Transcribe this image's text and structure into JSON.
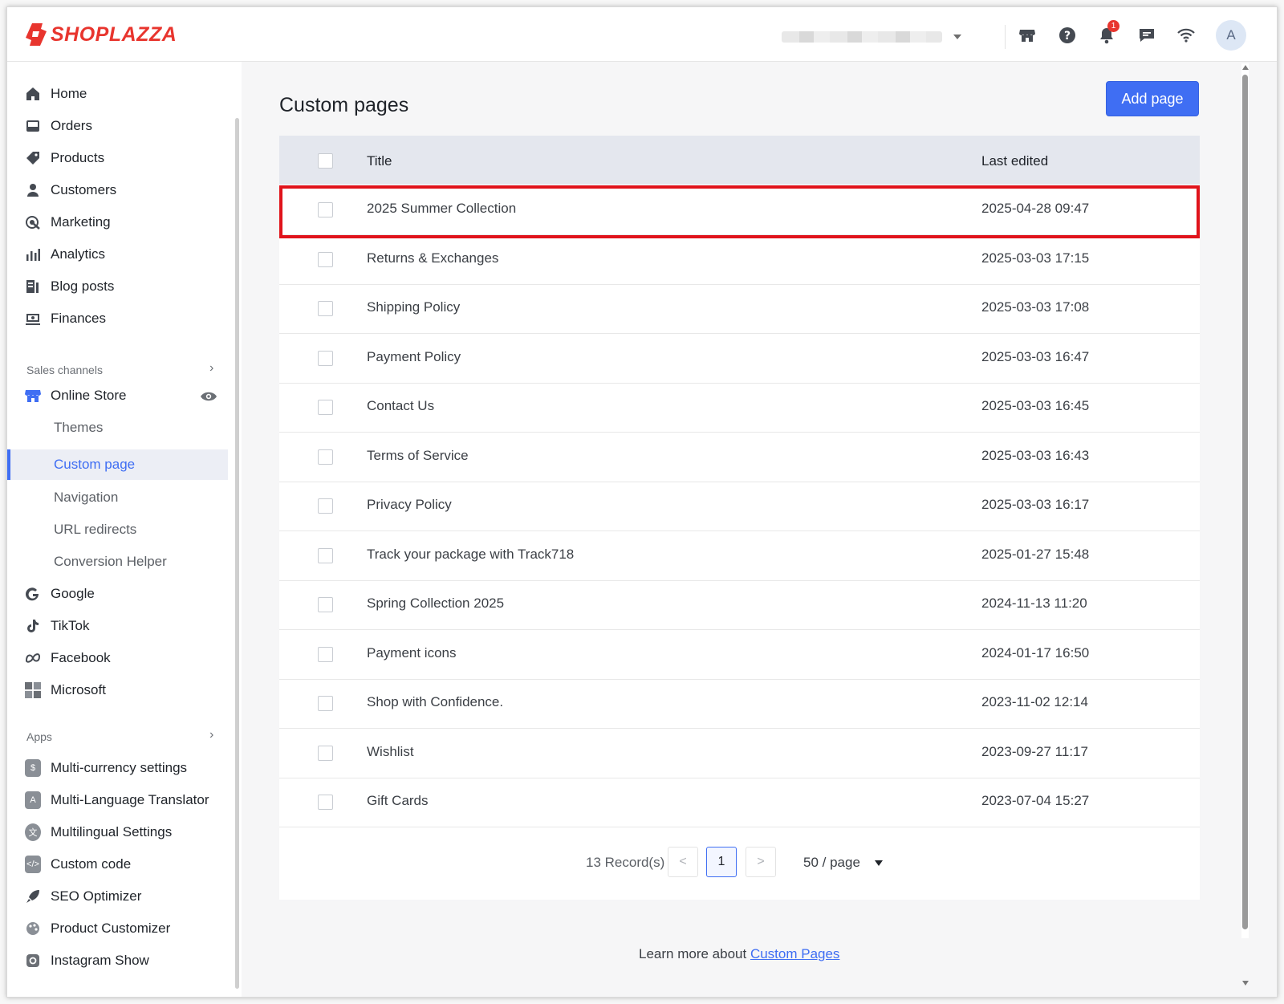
{
  "app": {
    "brand": "SHOPLAZZA",
    "brand_color": "#e8352e",
    "accent": "#3f6ef3"
  },
  "topbar": {
    "notifications_badge": "1",
    "avatar_initial": "A",
    "icons": [
      "store-icon",
      "help-icon",
      "bell-icon",
      "chat-icon",
      "wifi-icon"
    ]
  },
  "sidebar": {
    "main_items": [
      {
        "label": "Home",
        "icon": "home-icon"
      },
      {
        "label": "Orders",
        "icon": "orders-icon"
      },
      {
        "label": "Products",
        "icon": "tag-icon"
      },
      {
        "label": "Customers",
        "icon": "person-icon"
      },
      {
        "label": "Marketing",
        "icon": "marketing-icon"
      },
      {
        "label": "Analytics",
        "icon": "bar-chart-icon"
      },
      {
        "label": "Blog posts",
        "icon": "blog-icon"
      },
      {
        "label": "Finances",
        "icon": "finance-icon"
      }
    ],
    "sales_channels_label": "Sales channels",
    "online_store_label": "Online Store",
    "online_store_sub": [
      "Themes",
      "Custom page",
      "Navigation",
      "URL redirects",
      "Conversion Helper"
    ],
    "channels": [
      {
        "label": "Google",
        "icon": "google-icon"
      },
      {
        "label": "TikTok",
        "icon": "tiktok-icon"
      },
      {
        "label": "Facebook",
        "icon": "meta-icon"
      },
      {
        "label": "Microsoft",
        "icon": "microsoft-icon"
      }
    ],
    "apps_label": "Apps",
    "apps": [
      {
        "label": "Multi-currency settings"
      },
      {
        "label": "Multi-Language Translator"
      },
      {
        "label": "Multilingual Settings"
      },
      {
        "label": "Custom code"
      },
      {
        "label": "SEO Optimizer"
      },
      {
        "label": "Product Customizer"
      },
      {
        "label": "Instagram Show"
      }
    ]
  },
  "main": {
    "title": "Custom pages",
    "add_button": "Add page",
    "columns": {
      "title": "Title",
      "last_edited": "Last edited"
    },
    "rows": [
      {
        "title": "2025 Summer Collection",
        "date": "2025-04-28 09:47"
      },
      {
        "title": "Returns & Exchanges",
        "date": "2025-03-03 17:15"
      },
      {
        "title": "Shipping Policy",
        "date": "2025-03-03 17:08"
      },
      {
        "title": "Payment Policy",
        "date": "2025-03-03 16:47"
      },
      {
        "title": "Contact Us",
        "date": "2025-03-03 16:45"
      },
      {
        "title": "Terms of Service",
        "date": "2025-03-03 16:43"
      },
      {
        "title": "Privacy Policy",
        "date": "2025-03-03 16:17"
      },
      {
        "title": "Track your package with Track718",
        "date": "2025-01-27 15:48"
      },
      {
        "title": "Spring Collection 2025",
        "date": "2024-11-13 11:20"
      },
      {
        "title": "Payment icons",
        "date": "2024-01-17 16:50"
      },
      {
        "title": "Shop with Confidence.",
        "date": "2023-11-02 12:14"
      },
      {
        "title": "Wishlist",
        "date": "2023-09-27 11:17"
      },
      {
        "title": "Gift Cards",
        "date": "2023-07-04 15:27"
      }
    ],
    "pagination": {
      "records": "13 Record(s)",
      "current_page": "1",
      "per_page": "50 / page",
      "prev": "<",
      "next": ">"
    },
    "learn_more_prefix": "Learn more about",
    "learn_more_link": "Custom Pages"
  }
}
